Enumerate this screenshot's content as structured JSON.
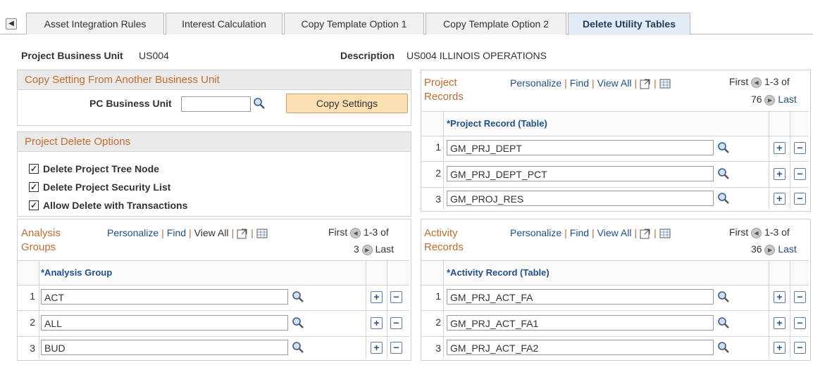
{
  "tabs": {
    "items": [
      "Asset Integration Rules",
      "Interest Calculation",
      "Copy Template Option 1",
      "Copy Template Option 2",
      "Delete Utility Tables"
    ],
    "active": "Delete Utility Tables"
  },
  "header": {
    "bu_label": "Project Business Unit",
    "bu_value": "US004",
    "desc_label": "Description",
    "desc_value": "US004 ILLINOIS OPERATIONS"
  },
  "copy_setting": {
    "title": "Copy Setting From Another Business Unit",
    "pc_bu_label": "PC Business Unit",
    "pc_bu_value": "",
    "button": "Copy Settings"
  },
  "delete_options": {
    "title": "Project Delete Options",
    "options": [
      {
        "label": "Delete Project Tree Node",
        "checked": true
      },
      {
        "label": "Delete Project Security List",
        "checked": true
      },
      {
        "label": "Allow Delete with Transactions",
        "checked": true
      }
    ]
  },
  "nav": {
    "personalize": "Personalize",
    "find": "Find",
    "view_all": "View All",
    "first": "First",
    "last": "Last"
  },
  "project_records": {
    "title_line1": "Project",
    "title_line2": "Records",
    "range": "1-3 of",
    "total": "76",
    "column": "*Project Record (Table)",
    "rows": [
      "GM_PRJ_DEPT",
      "GM_PRJ_DEPT_PCT",
      "GM_PROJ_RES"
    ]
  },
  "analysis_groups": {
    "title_line1": "Analysis",
    "title_line2": "Groups",
    "range": "1-3 of",
    "total": "3",
    "column": "*Analysis Group",
    "rows": [
      "ACT",
      "ALL",
      "BUD"
    ]
  },
  "activity_records": {
    "title_line1": "Activity",
    "title_line2": "Records",
    "range": "1-3 of",
    "total": "36",
    "column": "*Activity Record (Table)",
    "rows": [
      "GM_PRJ_ACT_FA",
      "GM_PRJ_ACT_FA1",
      "GM_PRJ_ACT_FA2"
    ]
  },
  "colors": {
    "accent": "#c46b2d",
    "link": "#1f4f8e",
    "button_bg": "#f9deb0"
  }
}
